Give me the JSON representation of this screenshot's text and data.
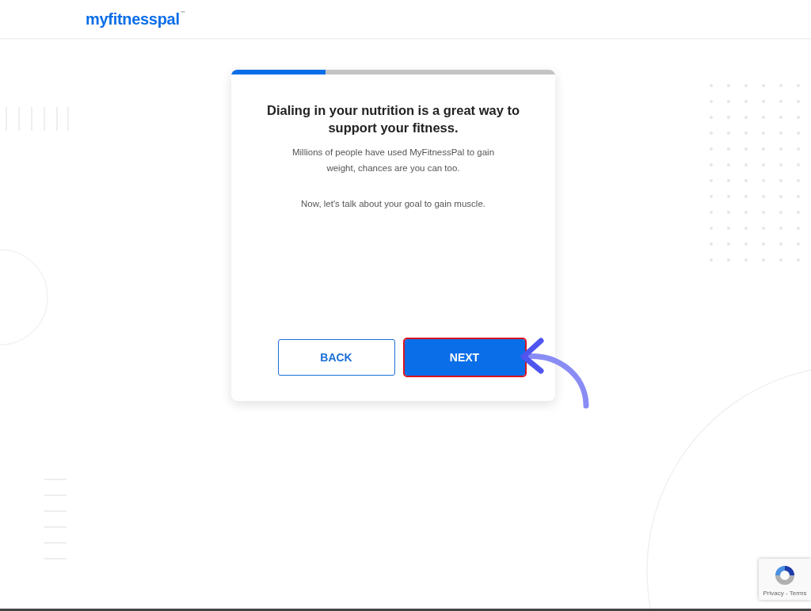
{
  "header": {
    "logo": "myfitnesspal",
    "logo_mark": "™"
  },
  "progress": {
    "level": 0.29
  },
  "card": {
    "title": "Dialing in your nutrition is a great way to support your fitness.",
    "paragraphs": [
      "Millions of people have used MyFitnessPal to gain weight, chances are you can too.",
      "Now, let's talk about your goal to gain muscle."
    ],
    "buttons": [
      {
        "label": "BACK",
        "kind": "secondary",
        "highlighted": false
      },
      {
        "label": "NEXT",
        "kind": "primary",
        "highlighted": true
      }
    ]
  },
  "recaptcha": {
    "links": "Privacy - Terms"
  }
}
